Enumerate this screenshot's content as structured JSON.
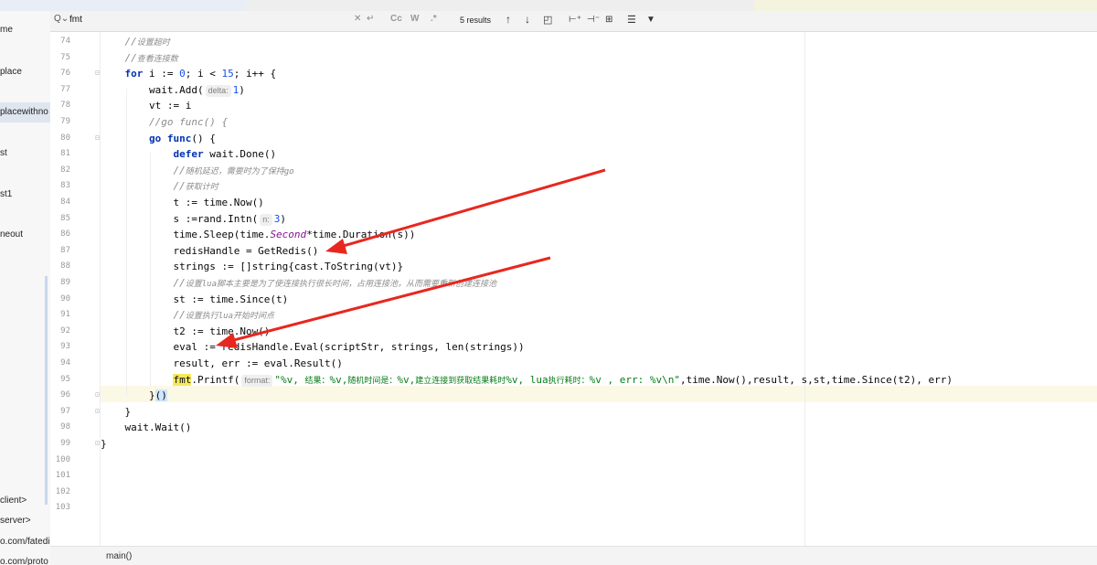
{
  "sidebar": {
    "items": [
      {
        "label": "me",
        "selected": false
      },
      {
        "label": "place",
        "selected": false
      },
      {
        "label": "placewithno",
        "selected": true
      },
      {
        "label": "st",
        "selected": false
      },
      {
        "label": "st1",
        "selected": false
      },
      {
        "label": "neout",
        "selected": false
      },
      {
        "label": "client>",
        "selected": false
      },
      {
        "label": "server>",
        "selected": false
      },
      {
        "label": "o.com/fatedi",
        "selected": false
      },
      {
        "label": "o.com/proto",
        "selected": false
      }
    ]
  },
  "search": {
    "value": "fmt",
    "results": "5 results",
    "toggles": [
      "Cc",
      "W",
      ".*"
    ]
  },
  "editor": {
    "lines": [
      {
        "n": "74",
        "html": "    <span class=\"cm\">//</span><span class=\"cmz\">设置超时</span>"
      },
      {
        "n": "75",
        "html": "    <span class=\"cm\">//</span><span class=\"cmz\">查看连接数</span>"
      },
      {
        "n": "76",
        "html": "    <span class=\"kw\">for</span> i := <span class=\"num\">0</span>; i &lt; <span class=\"num\">15</span>; i++ {"
      },
      {
        "n": "77",
        "html": "        wait.Add(<span class=\"hint\">delta:</span><span class=\"num\">1</span>)"
      },
      {
        "n": "78",
        "html": "        vt := i"
      },
      {
        "n": "79",
        "html": "        <span class=\"cm\">//go func() {</span>"
      },
      {
        "n": "80",
        "html": "        <span class=\"kw\">go</span> <span class=\"kw\">func</span>() {"
      },
      {
        "n": "81",
        "html": "            <span class=\"kw\">defer</span> wait.Done()"
      },
      {
        "n": "82",
        "html": "            <span class=\"cm\">//</span><span class=\"cmz\">随机延迟，需要时为了保持go</span>"
      },
      {
        "n": "83",
        "html": "            <span class=\"cm\">//</span><span class=\"cmz\">获取计时</span>"
      },
      {
        "n": "84",
        "html": "            t := time.Now()"
      },
      {
        "n": "85",
        "html": "            s :=rand.Intn(<span class=\"hint\">n:</span><span class=\"num\">3</span>)"
      },
      {
        "n": "86",
        "html": "            time.Sleep(time.<span class=\"fld\">Second</span>*time.Duration(s))"
      },
      {
        "n": "87",
        "html": "            redisHandle = GetRedis()"
      },
      {
        "n": "88",
        "html": "            strings := []string{cast.ToString(vt)}"
      },
      {
        "n": "89",
        "html": "            <span class=\"cm\">//</span><span class=\"cmz\">设置lua脚本主要是为了使连接执行很长时间，占用连接池，从而需要重新创建连接池</span>"
      },
      {
        "n": "90",
        "html": "            st := time.Since(t)"
      },
      {
        "n": "91",
        "html": "            <span class=\"cm\">//</span><span class=\"cmz\">设置执行lua开始时间点</span>"
      },
      {
        "n": "92",
        "html": "            t2 := time.Now()"
      },
      {
        "n": "93",
        "html": "            eval := redisHandle.Eval(scriptStr, strings, len(strings))"
      },
      {
        "n": "94",
        "html": "            result, err := eval.Result()"
      },
      {
        "n": "95",
        "html": "            <span class=\"match\">fmt</span>.Printf(<span class=\"hint\">format:</span><span class=\"str\">\"%v, </span><span class=\"strz\">结果：</span><span class=\"str\">%v,</span><span class=\"strz\">随机时间是：</span><span class=\"str\">%v,</span><span class=\"strz\">建立连接到获取结果耗时</span><span class=\"str\">%v, lua</span><span class=\"strz\">执行耗时：</span><span class=\"str\">%v , err: %v\\n\"</span>,time.Now(),result, s,st,time.Since(t2), err)"
      },
      {
        "n": "96",
        "html": "        }<span class=\"brace-hl\">()</span>"
      },
      {
        "n": "97",
        "html": "    }"
      },
      {
        "n": "98",
        "html": "    wait.Wait()"
      },
      {
        "n": "99",
        "html": "}"
      },
      {
        "n": "100",
        "html": ""
      },
      {
        "n": "101",
        "html": ""
      },
      {
        "n": "102",
        "html": ""
      },
      {
        "n": "103",
        "html": ""
      }
    ]
  },
  "status": {
    "breadcrumb": "main()"
  },
  "colors": {
    "keyword": "#0033b3",
    "comment": "#8c8c8c",
    "string": "#067d17",
    "number": "#1750eb",
    "arrow": "#e8271f",
    "search_match": "#f6e95c"
  }
}
